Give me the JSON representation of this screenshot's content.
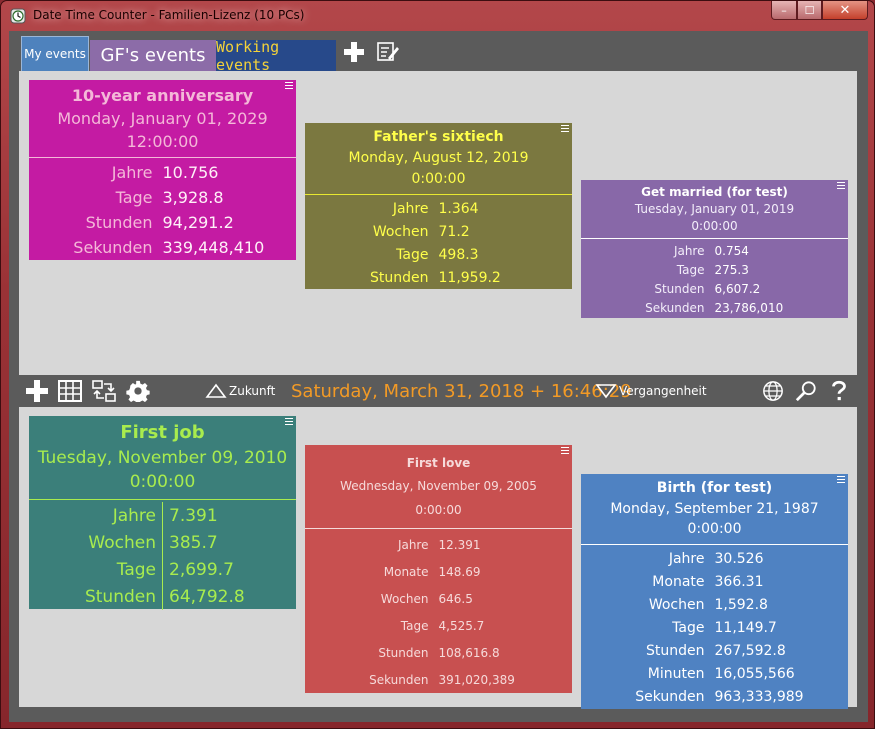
{
  "window": {
    "title": "Date Time Counter - Familien-Lizenz (10 PCs)",
    "minimize": "–",
    "maximize": "☐",
    "close": "✕"
  },
  "tabs": [
    {
      "label": "My events"
    },
    {
      "label": "GF's events"
    },
    {
      "label": "Working events"
    }
  ],
  "toolbar": {
    "future_label": "Zukunft",
    "past_label": "Vergangenheit",
    "current_datetime": "Saturday, March 31, 2018 + 16:46:29"
  },
  "colors": {
    "accent_orange": "#f29a26",
    "card_magenta": "#c41ba3",
    "card_olive": "#7b7840",
    "card_purple": "#8868a8",
    "card_teal": "#3b7f7a",
    "card_red": "#c85050",
    "card_blue": "#4f82c2"
  },
  "top_cards": [
    {
      "title": "10-year anniversary",
      "date": "Monday, January 01, 2029",
      "time": "12:00:00",
      "rows": [
        {
          "k": "Jahre",
          "v": "10.756"
        },
        {
          "k": "Tage",
          "v": "3,928.8"
        },
        {
          "k": "Stunden",
          "v": "94,291.2"
        },
        {
          "k": "Sekunden",
          "v": "339,448,410"
        }
      ]
    },
    {
      "title": "Father's sixtiech",
      "date": "Monday, August 12, 2019",
      "time": "0:00:00",
      "rows": [
        {
          "k": "Jahre",
          "v": "1.364"
        },
        {
          "k": "Wochen",
          "v": "71.2"
        },
        {
          "k": "Tage",
          "v": "498.3"
        },
        {
          "k": "Stunden",
          "v": "11,959.2"
        }
      ]
    },
    {
      "title": "Get married (for test)",
      "date": "Tuesday, January 01, 2019",
      "time": "0:00:00",
      "rows": [
        {
          "k": "Jahre",
          "v": "0.754"
        },
        {
          "k": "Tage",
          "v": "275.3"
        },
        {
          "k": "Stunden",
          "v": "6,607.2"
        },
        {
          "k": "Sekunden",
          "v": "23,786,010"
        }
      ]
    }
  ],
  "bottom_cards": [
    {
      "title": "First job",
      "date": "Tuesday, November 09, 2010",
      "time": "0:00:00",
      "rows": [
        {
          "k": "Jahre",
          "v": "7.391"
        },
        {
          "k": "Wochen",
          "v": "385.7"
        },
        {
          "k": "Tage",
          "v": "2,699.7"
        },
        {
          "k": "Stunden",
          "v": "64,792.8"
        }
      ]
    },
    {
      "title": "First love",
      "date": "Wednesday, November 09, 2005",
      "time": "0:00:00",
      "rows": [
        {
          "k": "Jahre",
          "v": "12.391"
        },
        {
          "k": "Monate",
          "v": "148.69"
        },
        {
          "k": "Wochen",
          "v": "646.5"
        },
        {
          "k": "Tage",
          "v": "4,525.7"
        },
        {
          "k": "Stunden",
          "v": "108,616.8"
        },
        {
          "k": "Sekunden",
          "v": "391,020,389"
        }
      ]
    },
    {
      "title": "Birth (for test)",
      "date": "Monday, September 21, 1987",
      "time": "0:00:00",
      "rows": [
        {
          "k": "Jahre",
          "v": "30.526"
        },
        {
          "k": "Monate",
          "v": "366.31"
        },
        {
          "k": "Wochen",
          "v": "1,592.8"
        },
        {
          "k": "Tage",
          "v": "11,149.7"
        },
        {
          "k": "Stunden",
          "v": "267,592.8"
        },
        {
          "k": "Minuten",
          "v": "16,055,566"
        },
        {
          "k": "Sekunden",
          "v": "963,333,989"
        }
      ]
    }
  ]
}
